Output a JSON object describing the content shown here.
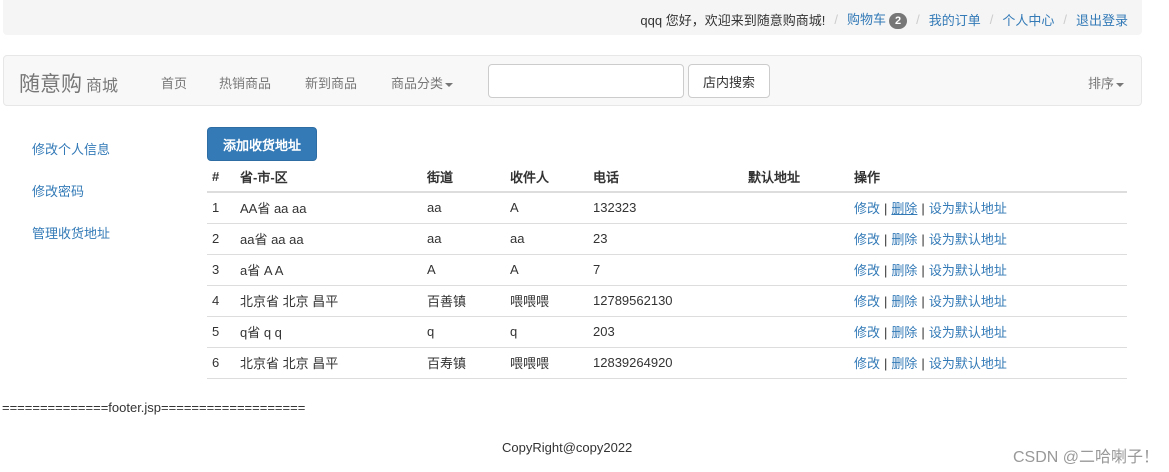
{
  "topbar": {
    "greeting": "qqq 您好，欢迎来到随意购商城!",
    "cart_label": "购物车",
    "cart_count": "2",
    "orders_label": "我的订单",
    "profile_label": "个人中心",
    "logout_label": "退出登录",
    "separator": "/"
  },
  "navbar": {
    "brand_main": "随意购",
    "brand_sub": "商城",
    "links": [
      "首页",
      "热销商品",
      "新到商品",
      "商品分类"
    ],
    "search_value": "",
    "search_button": "店内搜索",
    "sort_label": "排序"
  },
  "sidebar": {
    "items": [
      "修改个人信息",
      "修改密码",
      "管理收货地址"
    ]
  },
  "main": {
    "add_button": "添加收货地址",
    "columns": [
      "#",
      "省-市-区",
      "街道",
      "收件人",
      "电话",
      "默认地址",
      "操作"
    ],
    "rows": [
      {
        "num": "1",
        "region": "AA省 aa aa",
        "street": "aa",
        "recipient": "A",
        "phone": "132323",
        "default": ""
      },
      {
        "num": "2",
        "region": "aa省 aa aa",
        "street": "aa",
        "recipient": "aa",
        "phone": "23",
        "default": ""
      },
      {
        "num": "3",
        "region": "a省 A A",
        "street": "A",
        "recipient": "A",
        "phone": "7",
        "default": ""
      },
      {
        "num": "4",
        "region": "北京省 北京 昌平",
        "street": "百善镇",
        "recipient": "喂喂喂",
        "phone": "12789562130",
        "default": ""
      },
      {
        "num": "5",
        "region": "q省 q q",
        "street": "q",
        "recipient": "q",
        "phone": "203",
        "default": ""
      },
      {
        "num": "6",
        "region": "北京省 北京 昌平",
        "street": "百寿镇",
        "recipient": "喂喂喂",
        "phone": "12839264920",
        "default": ""
      }
    ],
    "actions": {
      "edit": "修改",
      "delete": "删除",
      "set_default": "设为默认地址",
      "divider": "|"
    }
  },
  "footer": {
    "marker": "==============footer.jsp===================",
    "copyright": "CopyRight@copy2022"
  },
  "watermark": "CSDN @二哈喇子！"
}
